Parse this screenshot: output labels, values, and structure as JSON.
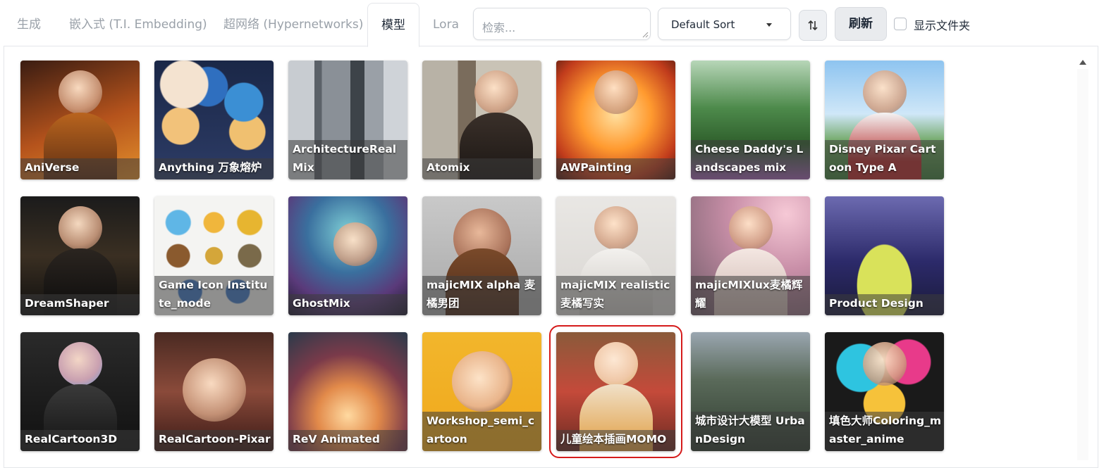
{
  "tabs": [
    {
      "label": "生成"
    },
    {
      "label": "嵌入式 (T.I. Embedding)"
    },
    {
      "label": "超网络 (Hypernetworks)"
    },
    {
      "label": "模型"
    },
    {
      "label": "Lora"
    }
  ],
  "active_tab": "模型",
  "search": {
    "placeholder": "检索..."
  },
  "sort": {
    "value": "Default Sort"
  },
  "refresh_label": "刷新",
  "show_folders_label": "显示文件夹",
  "cards": [
    {
      "label": "AniVerse"
    },
    {
      "label": "Anything 万象熔炉"
    },
    {
      "label": "ArchitectureRealMix"
    },
    {
      "label": "Atomix"
    },
    {
      "label": "AWPainting"
    },
    {
      "label": "Cheese Daddy's Landscapes mix"
    },
    {
      "label": "Disney Pixar Cartoon Type A"
    },
    {
      "label": "DreamShaper"
    },
    {
      "label": "Game Icon Institute_mode"
    },
    {
      "label": "GhostMix"
    },
    {
      "label": "majicMIX alpha 麦橘男团"
    },
    {
      "label": "majicMIX realistic 麦橘写实"
    },
    {
      "label": "majicMIXlux麦橘辉耀"
    },
    {
      "label": "Product Design"
    },
    {
      "label": "RealCartoon3D"
    },
    {
      "label": "RealCartoon-Pixar"
    },
    {
      "label": "ReV Animated"
    },
    {
      "label": "Workshop_semi_cartoon"
    },
    {
      "label": "儿童绘本插画MOMO"
    },
    {
      "label": "城市设计大模型 UrbanDesign"
    },
    {
      "label": "填色大师Coloring_master_anime"
    }
  ],
  "selected_card": "儿童绘本插画MOMO",
  "colors": {
    "selected_outline": "#d51b1b"
  }
}
